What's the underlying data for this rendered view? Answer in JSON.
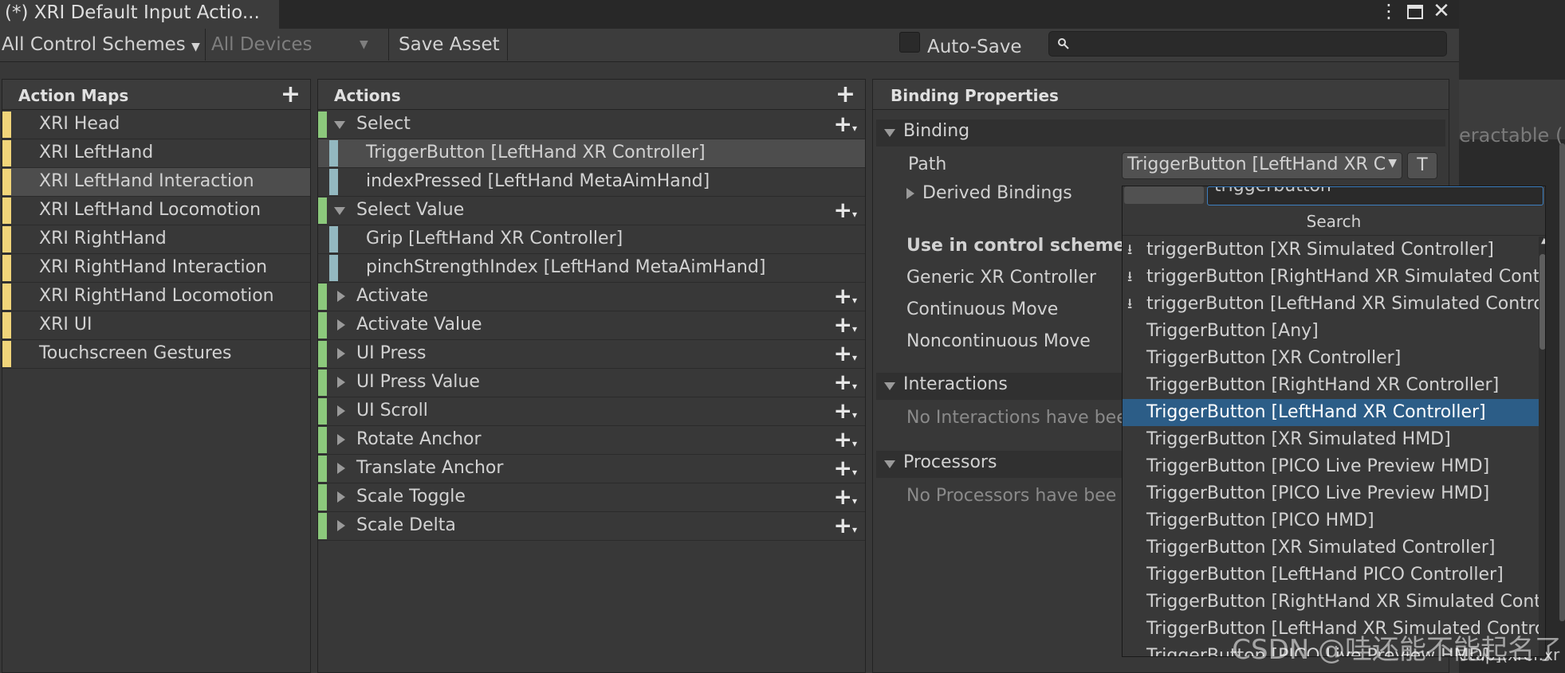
{
  "window": {
    "title": "(*) XRI Default Input Actio..."
  },
  "toolbar": {
    "control_schemes": "All Control Schemes",
    "devices": "All Devices",
    "save_asset": "Save Asset",
    "auto_save": "Auto-Save",
    "search_placeholder": ""
  },
  "action_maps": {
    "header": "Action Maps",
    "items": [
      {
        "label": "XRI Head"
      },
      {
        "label": "XRI LeftHand"
      },
      {
        "label": "XRI LeftHand Interaction"
      },
      {
        "label": "XRI LeftHand Locomotion"
      },
      {
        "label": "XRI RightHand"
      },
      {
        "label": "XRI RightHand Interaction"
      },
      {
        "label": "XRI RightHand Locomotion"
      },
      {
        "label": "XRI UI"
      },
      {
        "label": "Touchscreen Gestures"
      }
    ]
  },
  "actions": {
    "header": "Actions",
    "items": [
      {
        "label": "Select"
      },
      {
        "label": "TriggerButton [LeftHand XR Controller]"
      },
      {
        "label": "indexPressed [LeftHand MetaAimHand]"
      },
      {
        "label": "Select Value"
      },
      {
        "label": "Grip [LeftHand XR Controller]"
      },
      {
        "label": "pinchStrengthIndex [LeftHand MetaAimHand]"
      },
      {
        "label": "Activate"
      },
      {
        "label": "Activate Value"
      },
      {
        "label": "UI Press"
      },
      {
        "label": "UI Press Value"
      },
      {
        "label": "UI Scroll"
      },
      {
        "label": "Rotate Anchor"
      },
      {
        "label": "Translate Anchor"
      },
      {
        "label": "Scale Toggle"
      },
      {
        "label": "Scale Delta"
      }
    ]
  },
  "binding_properties": {
    "header": "Binding Properties",
    "binding_section": "Binding",
    "path_label": "Path",
    "path_value": "TriggerButton [LeftHand XR C",
    "t_button": "T",
    "derived_bindings": "Derived Bindings",
    "use_in_scheme": "Use in control scheme",
    "schemes": [
      "Generic XR Controller",
      "Continuous Move",
      "Noncontinuous Move"
    ],
    "interactions_section": "Interactions",
    "no_interactions": "No Interactions have bee",
    "processors_section": "Processors",
    "no_processors": "No Processors have bee"
  },
  "path_popup": {
    "search_title": "Search",
    "search_value": "triggerbutton",
    "items": [
      {
        "label": "triggerButton [XR Simulated Controller]"
      },
      {
        "label": "triggerButton [RightHand XR Simulated Controller]"
      },
      {
        "label": "triggerButton [LeftHand XR Simulated Controller]"
      },
      {
        "label": "TriggerButton [Any]"
      },
      {
        "label": "TriggerButton [XR Controller]"
      },
      {
        "label": "TriggerButton [RightHand XR Controller]"
      },
      {
        "label": "TriggerButton [LeftHand XR Controller]"
      },
      {
        "label": "TriggerButton [XR Simulated HMD]"
      },
      {
        "label": "TriggerButton [PICO Live Preview HMD]"
      },
      {
        "label": "TriggerButton [PICO Live Preview HMD]"
      },
      {
        "label": "TriggerButton [PICO HMD]"
      },
      {
        "label": "TriggerButton [XR Simulated Controller]"
      },
      {
        "label": "TriggerButton [LeftHand PICO Controller]"
      },
      {
        "label": "TriggerButton [RightHand XR Simulated Controller]"
      },
      {
        "label": "TriggerButton [LeftHand XR Simulated Controller]"
      },
      {
        "label": "TriggerButton [PICO Live Preview HMD]"
      }
    ]
  },
  "background_peek": {
    "interactable_fragment": "eractable (",
    "bottom_fragment": "etup](xref:xr"
  },
  "watermark": "CSDN @哇还能不能起名了",
  "colors": {
    "map_bar": "#f1d57a",
    "action_bar": "#8cc97c",
    "binding_bar": "#93b8c0",
    "selection": "#2c5d87"
  }
}
